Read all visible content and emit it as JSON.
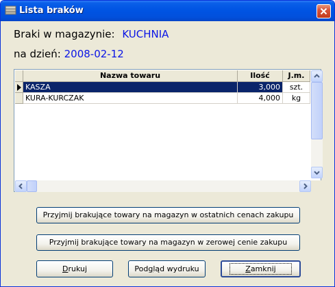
{
  "window": {
    "title": "Lista braków",
    "icon": "list-icon",
    "close_icon": "close-icon"
  },
  "header": {
    "magazyn_label": "Braki w magazynie:",
    "magazyn_value": "KUCHNIA",
    "date_label": "na dzień:",
    "date_value": "2008-02-12"
  },
  "table": {
    "columns": [
      "Nazwa towaru",
      "Ilość",
      "J.m."
    ],
    "rows": [
      {
        "name": "KASZA",
        "qty": "3,000",
        "unit": "szt.",
        "selected": true
      },
      {
        "name": "KURA-KURCZAK",
        "qty": "4,000",
        "unit": "kg",
        "selected": false
      }
    ]
  },
  "buttons": {
    "accept_last_price": "Przyjmij brakujące towary na magazyn w ostatnich cenach zakupu",
    "accept_zero_price": "Przyjmij brakujące towary na magazyn w zerowej cenie zakupu",
    "print": {
      "first": "D",
      "rest": "rukuj"
    },
    "preview": {
      "before": "Pod",
      "key": "g",
      "after": "ląd wydruku"
    },
    "close": {
      "first": "Z",
      "rest": "amknij"
    }
  },
  "colors": {
    "value_text": "#0a14e6",
    "selection": "#0a246a",
    "titlebar": "#0054e3"
  }
}
